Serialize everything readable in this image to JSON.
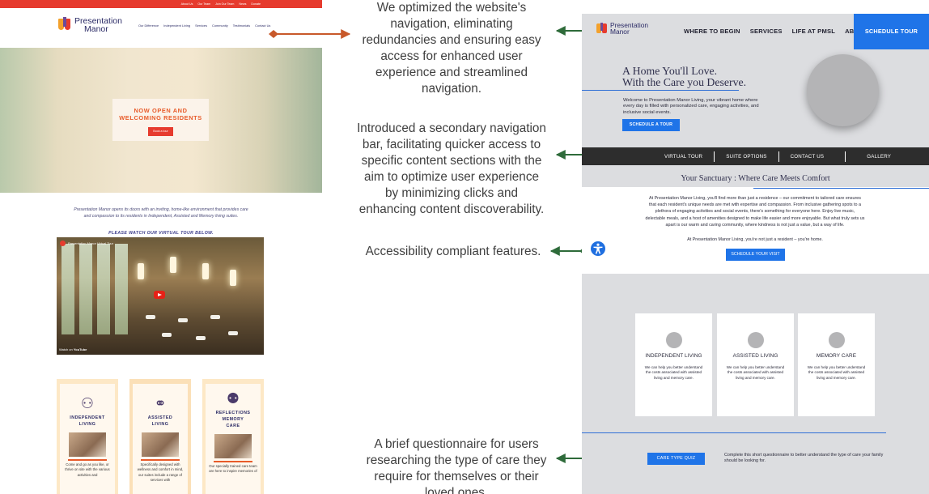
{
  "colors": {
    "arrow_orange": "#c8592a",
    "arrow_green": "#2e6b3a",
    "accent_blue": "#1f74e8",
    "old_red": "#e63b2e"
  },
  "annotations": {
    "navigation": [
      "We optimized the website's",
      "navigation, eliminating",
      "redundancies and ensuring easy",
      "access for enhanced user",
      "experience and streamlined",
      "navigation."
    ],
    "secondary_nav": [
      "Introduced a secondary navigation",
      "bar, facilitating quicker access to",
      "specific content sections with the",
      "aim to optimize user experience",
      "by minimizing clicks and",
      "enhancing content discoverability."
    ],
    "accessibility": "Accessibility compliant features.",
    "quiz": [
      "A brief questionnaire for users",
      "researching the type of care they",
      "require for themselves or their",
      "loved ones."
    ]
  },
  "old_site": {
    "topbar": [
      "About Us",
      "Our Team",
      "Join Our Team",
      "News",
      "Donate"
    ],
    "brand": [
      "Presentation",
      "Manor"
    ],
    "nav": [
      "Our Difference",
      "Independent Living",
      "Services",
      "Community",
      "Testimonials",
      "Contact Us"
    ],
    "hero_title": [
      "NOW OPEN AND",
      "WELCOMING RESIDENTS"
    ],
    "hero_button": "Book a tour",
    "intro": "Presentation Manor opens its doors with an inviting, home-like environment that provides care and compassion to its residents in Independent, Assisted and Memory living suites.",
    "watch": "PLEASE WATCH OUR VIRTUAL TOUR BELOW.",
    "video_title": "Presentation Manor Virtual Tour",
    "video_watch": "Watch on",
    "video_yt": "YouTube",
    "cards": [
      {
        "icon": "people-walking-icon",
        "title": [
          "INDEPENDENT",
          "LIVING"
        ],
        "text": "Come and go as you like, or thrive on site with the various activities and"
      },
      {
        "icon": "handshake-icon",
        "title": [
          "ASSISTED",
          "LIVING"
        ],
        "text": "Specifically designed with wellness and comfort in mind, our suites include a range of services with"
      },
      {
        "icon": "group-icon",
        "title": [
          "REFLECTIONS",
          "MEMORY",
          "CARE"
        ],
        "text": "Our specially trained care team are here to inspire memories of"
      }
    ]
  },
  "new_site": {
    "brand": [
      "Presentation",
      "Manor"
    ],
    "nav": [
      "WHERE TO BEGIN",
      "SERVICES",
      "LIFE AT PMSL",
      "ABOUT US"
    ],
    "cta": "SCHEDULE TOUR",
    "headline": [
      "A Home You'll Love.",
      "With the Care you Deserve."
    ],
    "intro": "Welcome to Presentation Manor Living, your vibrant home where every day is filled with personalized care, engaging activities, and inclusive social events.",
    "hero_button": "SCHEDULE A TOUR",
    "subnav": [
      "VIRTUAL TOUR",
      "SUITE OPTIONS",
      "CONTACT US",
      "GALLERY"
    ],
    "section_title": "Your Sanctuary : Where Care Meets Comfort",
    "body": "At Presentation Manor Living, you'll find more than just a residence – our commitment to tailored care ensures that each resident's unique needs are met with expertise and compassion. From inclusive gathering spots to a plethora of engaging activities and social events, there's something for everyone here. Enjoy live music, delectable meals, and a host of amenities designed to make life easier and more enjoyable. But what truly sets us apart is our warm and caring community, where kindness is not just a value, but a way of life.",
    "body2": "At Presentation Manor Living, you're not just a resident – you're home.",
    "visit_button": "SCHEDULE YOUR VISIT",
    "cards": [
      {
        "title": "INDEPENDENT LIVING",
        "text": "We can help you better understand the costs associated with assisted living and memory care."
      },
      {
        "title": "ASSISTED LIVING",
        "text": "We can help you better understand the costs associated with assisted living and memory care."
      },
      {
        "title": "MEMORY CARE",
        "text": "We can help you better understand the costs associated with assisted living and memory care."
      }
    ],
    "quiz_button": "CARE TYPE QUIZ",
    "quiz_text": "Complete this short questionnaire to better understand the type of care your family should be looking for."
  }
}
